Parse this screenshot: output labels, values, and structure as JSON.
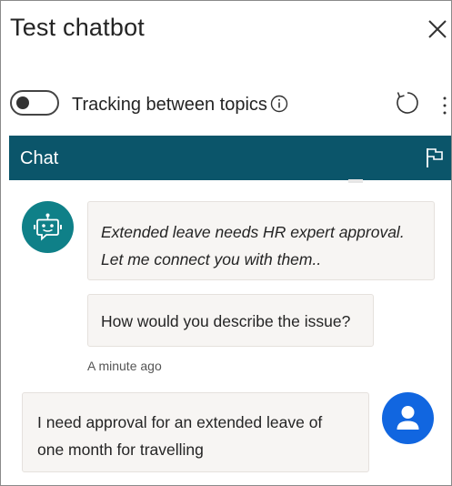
{
  "panel": {
    "title": "Test chatbot"
  },
  "controls": {
    "tracking_label": "Tracking between topics",
    "tracking_enabled": false
  },
  "chat": {
    "header_label": "Chat",
    "messages": [
      {
        "from": "bot",
        "lines": [
          "Extended leave needs HR expert approval.",
          "Let me connect you with them.."
        ],
        "italic": true
      },
      {
        "from": "bot",
        "text": "How would you describe the issue?"
      },
      {
        "from": "user",
        "lines": [
          "I need approval for an extended leave of",
          "one month for travelling"
        ]
      }
    ],
    "timestamp": "A minute ago"
  },
  "icons": {
    "close": "close-icon",
    "info": "info-icon",
    "refresh": "refresh-icon",
    "more": "more-options-icon",
    "flag": "flag-icon",
    "bot": "bot-icon",
    "user": "user-icon"
  },
  "colors": {
    "header_bg": "#0b556a",
    "bot_avatar": "#0f8088",
    "user_avatar": "#1166e0",
    "bubble_bg": "#f7f5f3"
  }
}
